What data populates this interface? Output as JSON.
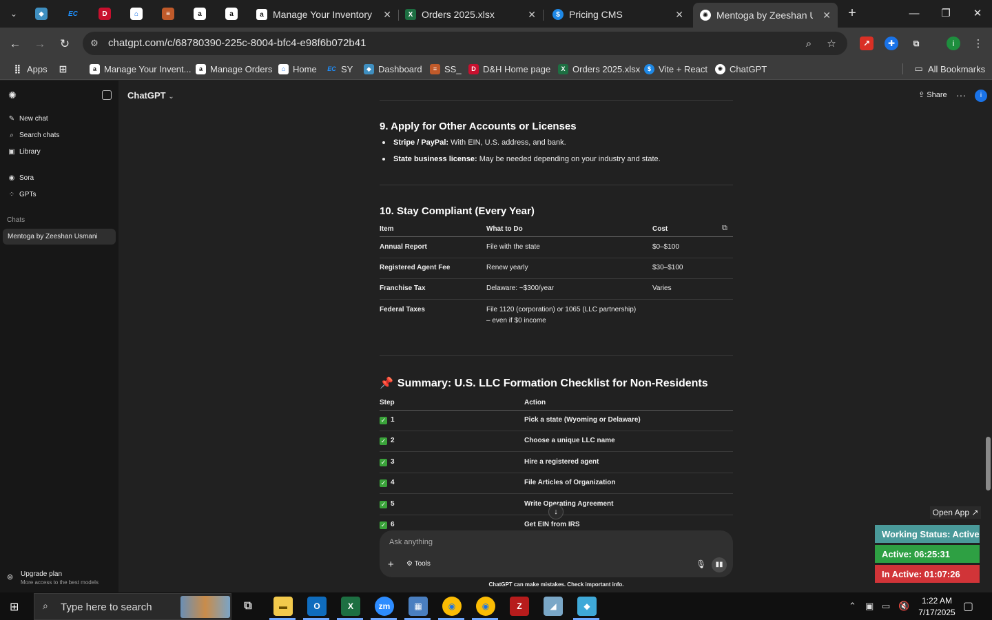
{
  "browser": {
    "tabs": [
      {
        "title": "Manage Your Inventory",
        "favicon": "a"
      },
      {
        "title": "Orders 2025.xlsx",
        "favicon": "X"
      },
      {
        "title": "Pricing CMS",
        "favicon": "$"
      },
      {
        "title": "Mentoga by Zeeshan Usmani",
        "favicon": "gpt"
      }
    ],
    "url": "chatgpt.com/c/68780390-225c-8004-bfc4-e98f6b072b41",
    "bookmarks": [
      {
        "label": "Apps"
      },
      {
        "label": "Manage Your Invent..."
      },
      {
        "label": "Manage Orders"
      },
      {
        "label": "Home"
      },
      {
        "label": "SY"
      },
      {
        "label": "Dashboard"
      },
      {
        "label": "SS_"
      },
      {
        "label": "D&H Home page"
      },
      {
        "label": "Orders 2025.xlsx"
      },
      {
        "label": "Vite + React"
      },
      {
        "label": "ChatGPT"
      }
    ],
    "all_bookmarks": "All Bookmarks",
    "profile_initial": "i"
  },
  "sidebar": {
    "items": [
      "New chat",
      "Search chats",
      "Library",
      "Sora",
      "GPTs"
    ],
    "chats_heading": "Chats",
    "active_chat": "Mentoga by Zeeshan Usmani",
    "upgrade_title": "Upgrade plan",
    "upgrade_sub": "More access to the best models"
  },
  "header": {
    "model": "ChatGPT",
    "share": "Share"
  },
  "content": {
    "sec9_title": "9. Apply for Other Accounts or Licenses",
    "sec9_bullets": [
      {
        "bold": "Stripe / PayPal:",
        "text": " With EIN, U.S. address, and bank."
      },
      {
        "bold": "State business license:",
        "text": " May be needed depending on your industry and state."
      }
    ],
    "sec10_title": "10. Stay Compliant (Every Year)",
    "table10_headers": [
      "Item",
      "What to Do",
      "Cost"
    ],
    "table10_rows": [
      [
        "Annual Report",
        "File with the state",
        "$0–$100"
      ],
      [
        "Registered Agent Fee",
        "Renew yearly",
        "$30–$100"
      ],
      [
        "Franchise Tax",
        "Delaware: ~$300/year",
        "Varies"
      ],
      [
        "Federal Taxes",
        "File 1120 (corporation) or 1065 (LLC partnership) – even if $0 income",
        ""
      ]
    ],
    "summary_title": "Summary: U.S. LLC Formation Checklist for Non-Residents",
    "summary_headers": [
      "Step",
      "Action"
    ],
    "summary_rows": [
      [
        "1",
        "Pick a state (Wyoming or Delaware)"
      ],
      [
        "2",
        "Choose a unique LLC name"
      ],
      [
        "3",
        "Hire a registered agent"
      ],
      [
        "4",
        "File Articles of Organization"
      ],
      [
        "5",
        "Write Operating Agreement"
      ],
      [
        "6",
        "Get EIN from IRS"
      ]
    ]
  },
  "composer": {
    "placeholder": "Ask anything",
    "tools": "Tools",
    "disclaimer": "ChatGPT can make mistakes. Check important info."
  },
  "widget": {
    "open_app": "Open App ↗",
    "working_status": "Working Status: Active",
    "active": "Active: 06:25:31",
    "inactive": "In Active: 01:07:26",
    "colors": {
      "working": "#4a9a9a",
      "active": "#2ea043",
      "inactive": "#d13438"
    }
  },
  "taskbar": {
    "search_placeholder": "Type here to search",
    "time": "1:22 AM",
    "date": "7/17/2025"
  }
}
